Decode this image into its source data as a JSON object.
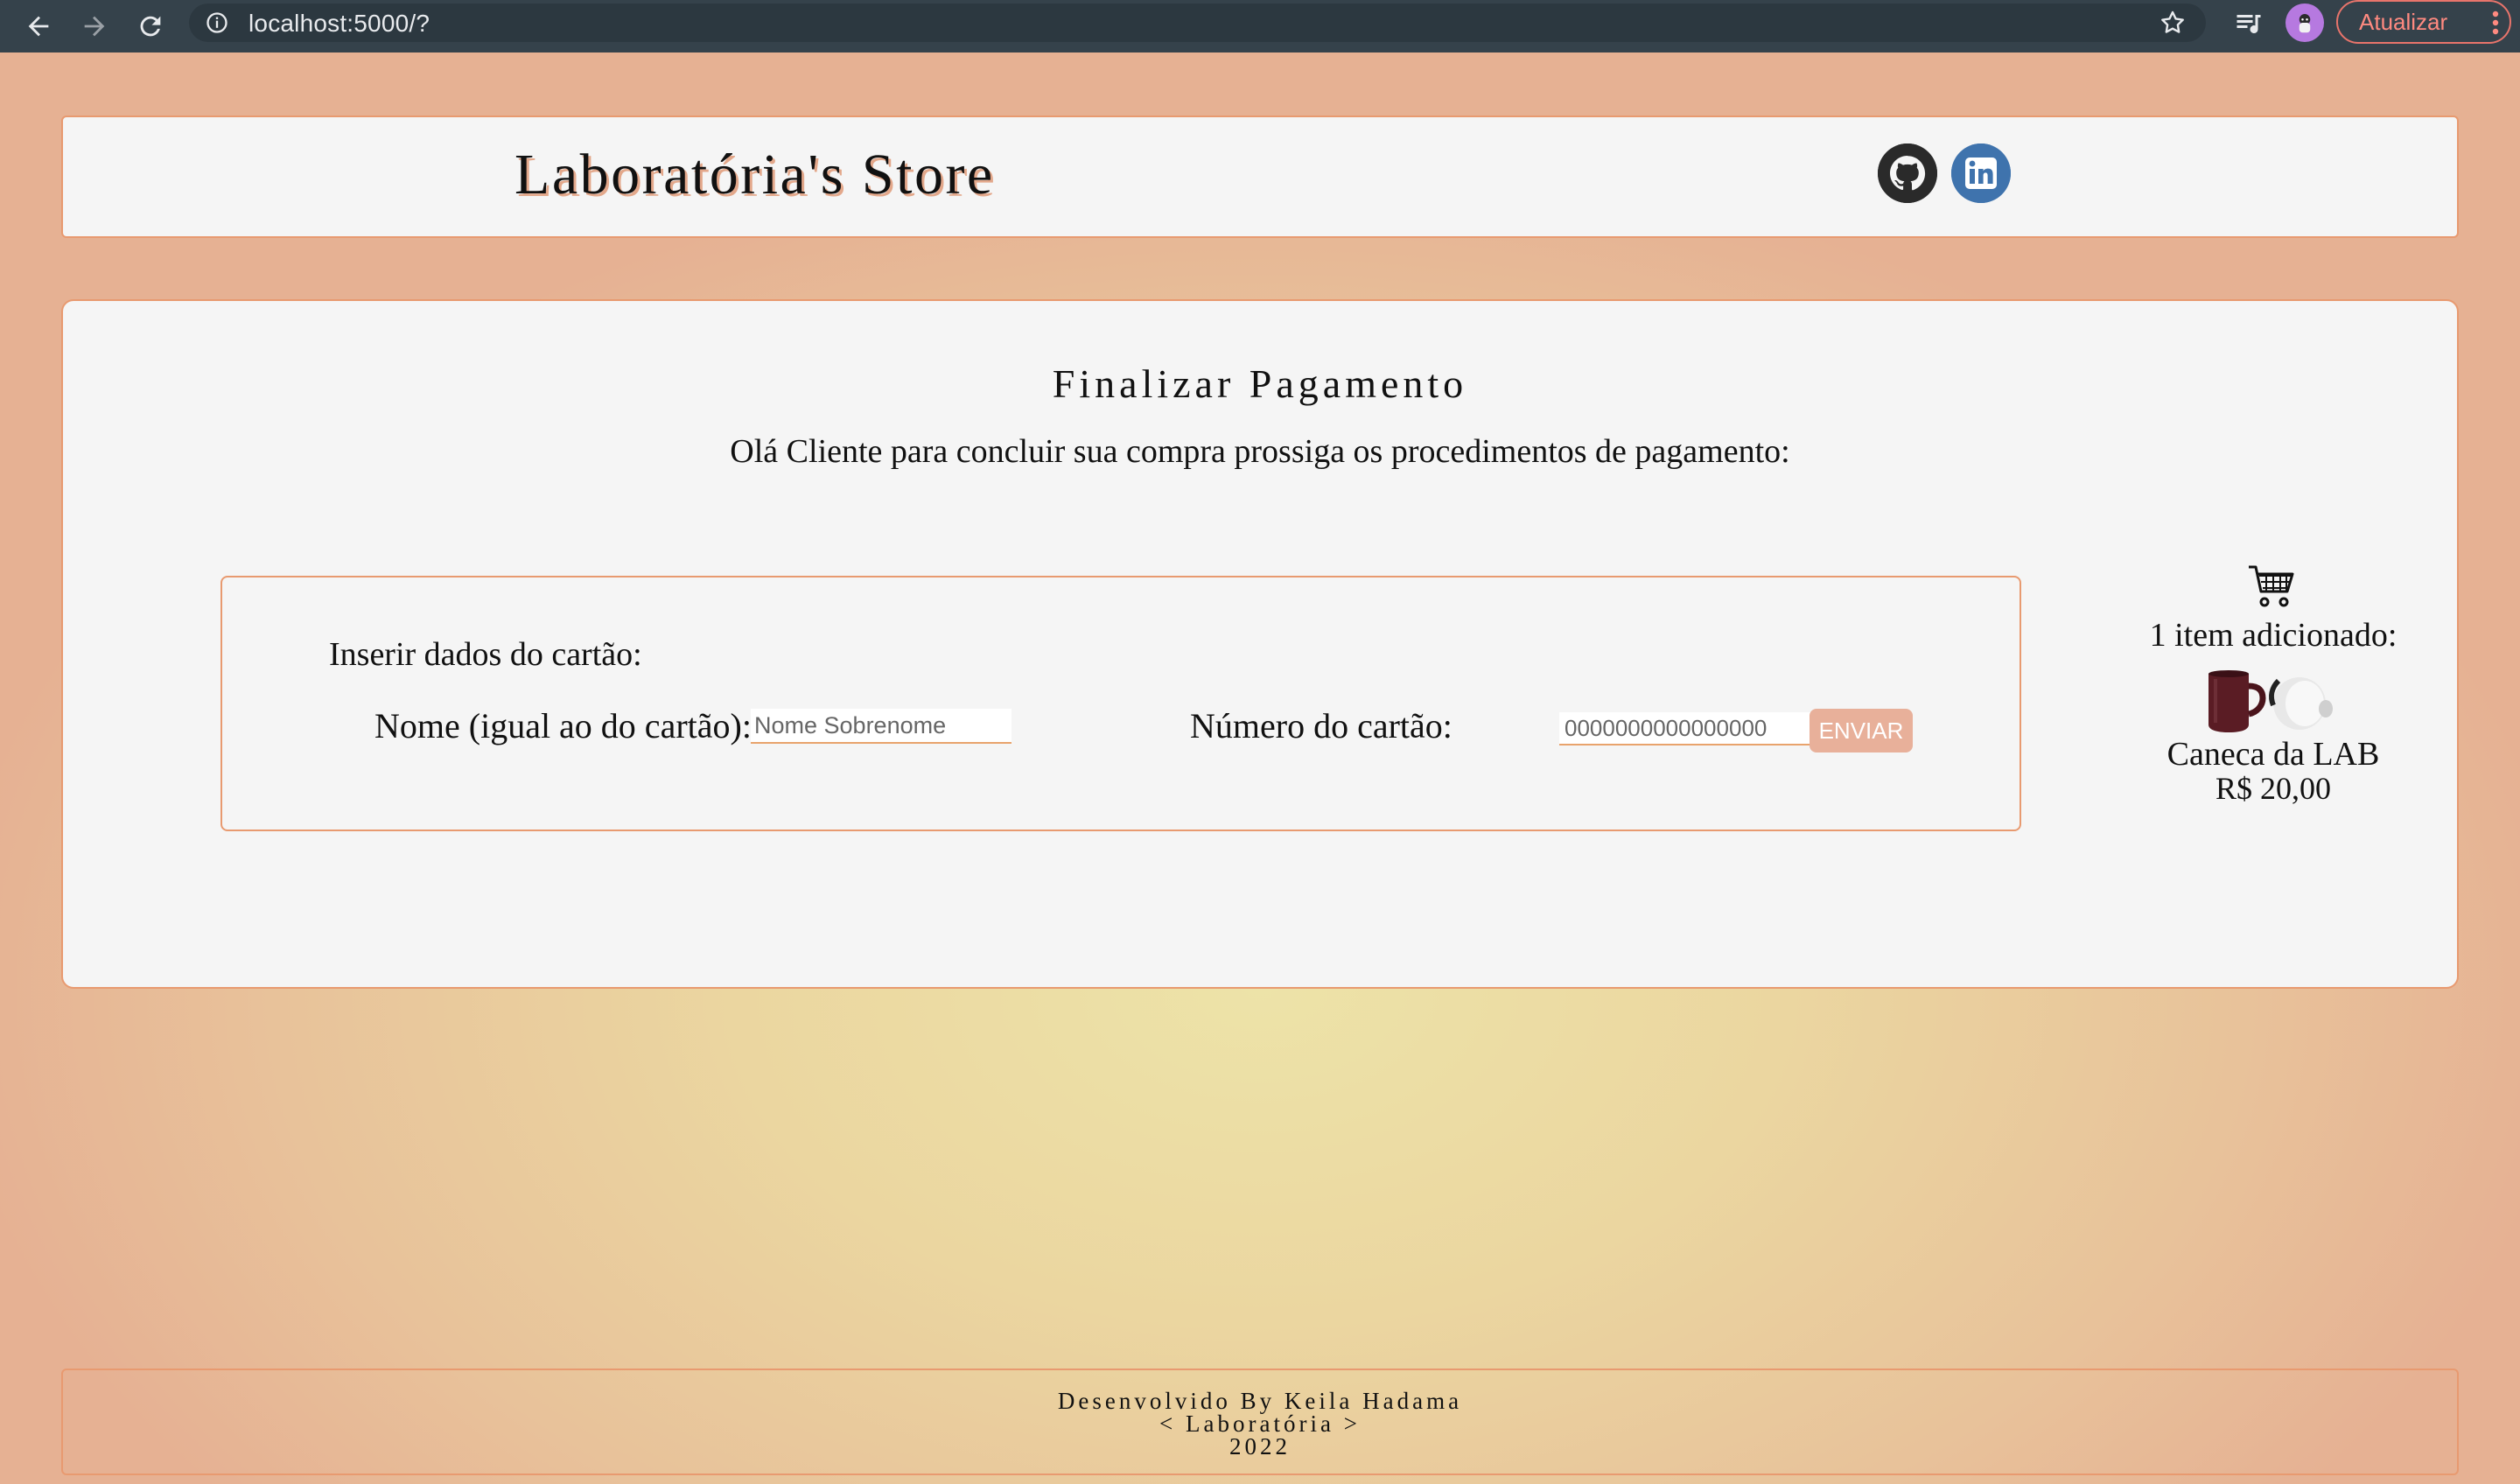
{
  "browser": {
    "url": "localhost:5000/?",
    "update_label": "Atualizar"
  },
  "header": {
    "store_title": "Laboratória's Store",
    "social": [
      "github-icon",
      "linkedin-icon"
    ]
  },
  "main": {
    "title": "Finalizar Pagamento",
    "subtitle": "Olá Cliente para concluir sua compra prossiga os procedimentos de pagamento:",
    "card_form": {
      "heading": "Inserir dados do cartão:",
      "name_label": "Nome (igual ao do cartão):",
      "name_placeholder": "Nome Sobrenome",
      "number_label": "Número do cartão:",
      "number_placeholder": "0000000000000000",
      "send_label": "ENVIAR"
    },
    "cart": {
      "count_text": "1 item adicionado:",
      "product_name": "Caneca da LAB",
      "product_price": "R$ 20,00"
    }
  },
  "footer": {
    "line1": "Desenvolvido By Keila Hadama",
    "line2": "< Laboratória >",
    "line3": "2022"
  },
  "colors": {
    "accent_border": "#e89a70",
    "button_bg": "#e8b09a",
    "chrome_bg": "#35424b",
    "linkedin": "#3f73ad"
  }
}
